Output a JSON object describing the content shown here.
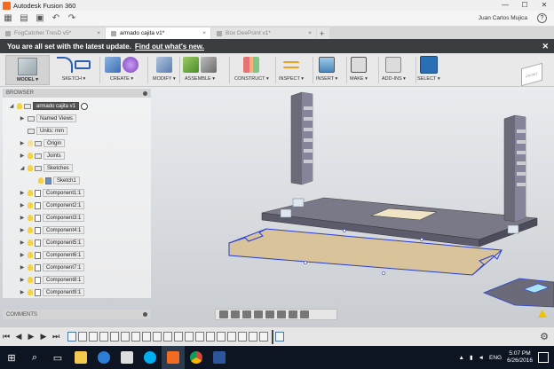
{
  "window": {
    "title": "Autodesk Fusion 360",
    "buttons": [
      "—",
      "☐",
      "✕"
    ]
  },
  "quick_access": {
    "user": "Juan Carlos Mujica",
    "help": "?"
  },
  "tabs": [
    {
      "label": "FogCatcher TresD v5*",
      "active": false
    },
    {
      "label": "armado cajita v1*",
      "active": true
    },
    {
      "label": "Box DeePoint v1*",
      "active": false
    }
  ],
  "notification": {
    "text": "You are all set with the latest update.",
    "link": "Find out what's new."
  },
  "toolbar": {
    "model_label": "MODEL ▾",
    "groups": [
      {
        "label": "SKETCH ▾"
      },
      {
        "label": "CREATE ▾"
      },
      {
        "label": "MODIFY ▾"
      },
      {
        "label": "ASSEMBLE ▾"
      },
      {
        "label": "CONSTRUCT ▾"
      },
      {
        "label": "INSPECT ▾"
      },
      {
        "label": "INSERT ▾"
      },
      {
        "label": "MAKE ▾"
      },
      {
        "label": "ADD-INS ▾"
      },
      {
        "label": "SELECT ▾"
      }
    ]
  },
  "browser": {
    "header": "BROWSER",
    "root": "armado cajita v1",
    "named_views": "Named Views",
    "units": "Units: mm",
    "origin": "Origin",
    "joints": "Joints",
    "sketches": "Sketches",
    "sketch1": "Sketch1",
    "components": [
      "Component1:1",
      "Component2:1",
      "Component3:1",
      "Component4:1",
      "Component5:1",
      "Component6:1",
      "Component7:1",
      "Component8:1",
      "Component9:1"
    ]
  },
  "comments": {
    "label": "COMMENTS"
  },
  "viewcube": {
    "label": "FRONT"
  },
  "taskbar": {
    "language": "ENG",
    "time": "5:07 PM",
    "date": "6/26/2016"
  },
  "colors": {
    "notify_bg": "#3a3d40",
    "sketch_line": "#2a3fd0",
    "wood_top": "#6b6a78",
    "taskbar_bg": "#0c1521"
  }
}
